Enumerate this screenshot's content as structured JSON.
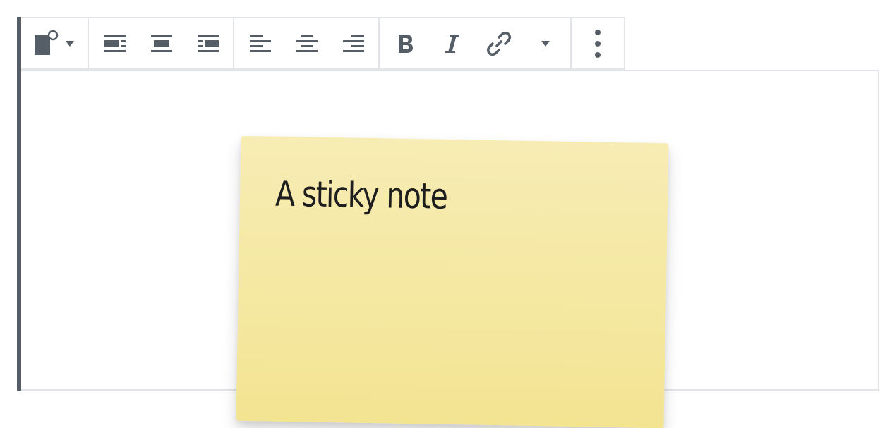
{
  "toolbar": {
    "groups": [
      {
        "name": "block-type",
        "buttons": [
          "sticky-note-icon",
          "caret-down-icon"
        ]
      },
      {
        "name": "block-align",
        "buttons": [
          "align-left-icon",
          "align-center-icon",
          "align-right-icon"
        ]
      },
      {
        "name": "text-align",
        "buttons": [
          "text-align-left-icon",
          "text-align-center-icon",
          "text-align-right-icon"
        ]
      },
      {
        "name": "format",
        "buttons": [
          "bold-icon",
          "italic-icon",
          "link-icon",
          "caret-down-icon"
        ]
      },
      {
        "name": "more",
        "buttons": [
          "more-options-icon"
        ]
      }
    ],
    "icon_color": "#555d66",
    "border_color": "#e2e4e7"
  },
  "note": {
    "text": "A sticky note",
    "color": "#f5e8a3"
  }
}
